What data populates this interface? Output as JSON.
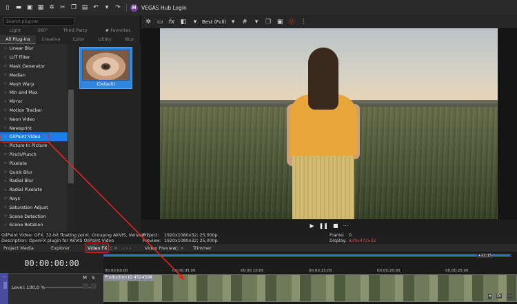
{
  "toolbar": {
    "hub_label": "VEGAS Hub Login",
    "icons": [
      "new-file-icon",
      "open-folder-icon",
      "save-icon",
      "render-icon",
      "settings-icon",
      "cut-icon",
      "copy-icon",
      "paste-icon",
      "undo-icon",
      "redo-icon"
    ]
  },
  "plugin_panel": {
    "search_placeholder": "Search plug-ins",
    "tabs_row1": [
      "Light",
      "360°",
      "Third Party",
      "Favorites"
    ],
    "tabs_row2": [
      "All Plug-ins",
      "Creative",
      "Color",
      "Utility",
      "Blur"
    ],
    "items": [
      "Linear Blur",
      "LUT Filter",
      "Mask Generator",
      "Median",
      "Mesh Warp",
      "Min and Max",
      "Mirror",
      "Motion Tracker",
      "Neon Video",
      "Newsprint",
      "OilPaint Video",
      "Picture In Picture",
      "Pinch/Punch",
      "Pixelate",
      "Quick Blur",
      "Radial Blur",
      "Radial Pixelate",
      "Rays",
      "Saturation Adjust",
      "Scene Detection",
      "Scene Rotation"
    ],
    "selected_item": "OilPaint Video",
    "preset_label": "(Default)"
  },
  "preview": {
    "quality": "Best (Full)"
  },
  "info": {
    "line1": "OilPaint Video: OFX, 32-bit floating point, Grouping AKVIS, Version 1",
    "line2": "Description: OpenFX plugin for AKVIS OilPaint Video",
    "project_label": "Project:",
    "project_value": "1920x1080x32; 25,000p",
    "preview_label": "Preview:",
    "preview_value": "1920x1080x32; 25,000p",
    "frame_label": "Frame:",
    "frame_value": "0",
    "display_label": "Display:",
    "display_value": "839x472x32"
  },
  "panel_tabs": [
    "Project Media",
    "Explorer",
    "Video FX",
    "Video Preview",
    "Trimmer"
  ],
  "timeline": {
    "timecode": "00:00:00:00",
    "level": "Level: 100,0 %",
    "ruler_end": "+22:15",
    "ticks": [
      "00:00:00:00",
      "00:00:05:00",
      "00:00:10:00",
      "00:00:15:00",
      "00:00:20:00",
      "00:00:25:00"
    ],
    "clip_label": "Production ID 4524598"
  },
  "colors": {
    "accent": "#1e7de0",
    "annotation": "#e0261e"
  }
}
